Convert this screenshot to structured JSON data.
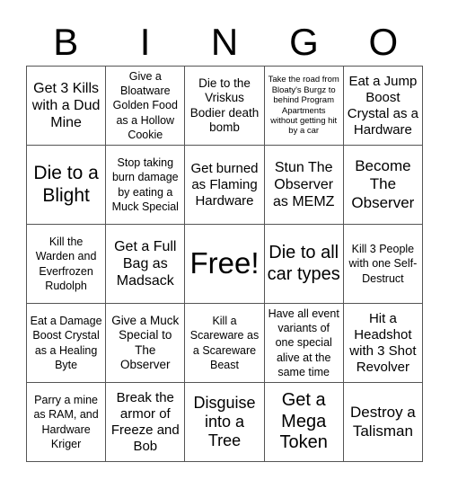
{
  "header": {
    "letters": [
      "B",
      "I",
      "N",
      "G",
      "O"
    ]
  },
  "cells": [
    [
      "Get 3 Kills with a Dud Mine",
      "Give a Bloatware Golden Food as a Hollow Cookie",
      "Die to the Vriskus Bodier death bomb",
      "Take the road from Bloaty's Burgz to behind Program Apartments without getting hit by a car",
      "Eat a Jump Boost Crystal as a Hardware"
    ],
    [
      "Die to a Blight",
      "Stop taking burn damage by eating a Muck Special",
      "Get burned as Flaming Hardware",
      "Stun The Observer as MEMZ",
      "Become The Observer"
    ],
    [
      "Kill the Warden and Everfrozen Rudolph",
      "Get a Full Bag as Madsack",
      "Free!",
      "Die to all car types",
      "Kill 3 People with one Self-Destruct"
    ],
    [
      "Eat a Damage Boost Crystal as a Healing Byte",
      "Give a Muck Special to The Observer",
      "Kill a Scareware as a Scareware Beast",
      "Have all event variants of one special alive at the same time",
      "Hit a Headshot with 3 Shot Revolver"
    ],
    [
      "Parry a mine as RAM, and Hardware Kriger",
      "Break the armor of Freeze and Bob",
      "Disguise into a Tree",
      "Get a Mega Token",
      "Destroy a Talisman"
    ]
  ]
}
